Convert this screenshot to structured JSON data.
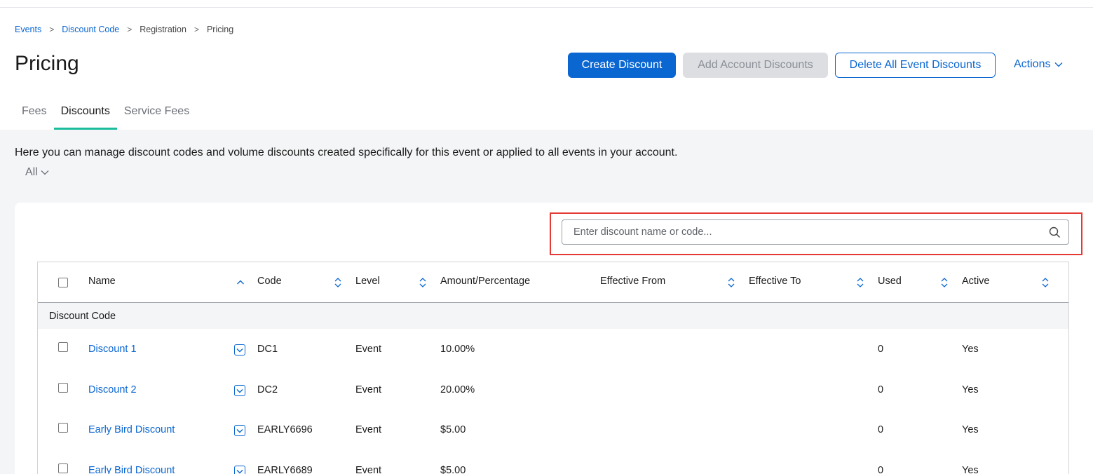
{
  "breadcrumb": {
    "items": [
      {
        "label": "Events",
        "link": true
      },
      {
        "label": "Discount Code",
        "link": true
      },
      {
        "label": "Registration",
        "link": false
      },
      {
        "label": "Pricing",
        "link": false
      }
    ],
    "separator": ">"
  },
  "page": {
    "title": "Pricing"
  },
  "toolbar": {
    "create_label": "Create Discount",
    "add_account_label": "Add Account Discounts",
    "delete_all_label": "Delete All Event Discounts",
    "actions_label": "Actions"
  },
  "tabs": [
    {
      "label": "Fees",
      "active": false
    },
    {
      "label": "Discounts",
      "active": true
    },
    {
      "label": "Service Fees",
      "active": false
    }
  ],
  "intro_text": "Here you can manage discount codes and volume discounts created specifically for this event or applied to all events in your account.",
  "filter": {
    "selected": "All"
  },
  "search": {
    "placeholder": "Enter discount name or code...",
    "value": ""
  },
  "table": {
    "columns": [
      "Name",
      "Code",
      "Level",
      "Amount/Percentage",
      "Effective From",
      "Effective To",
      "Used",
      "Active"
    ],
    "group_label": "Discount Code",
    "rows": [
      {
        "name": "Discount 1",
        "code": "DC1",
        "level": "Event",
        "amount": "10.00%",
        "from": "",
        "to": "",
        "used": "0",
        "active": "Yes"
      },
      {
        "name": "Discount 2",
        "code": "DC2",
        "level": "Event",
        "amount": "20.00%",
        "from": "",
        "to": "",
        "used": "0",
        "active": "Yes"
      },
      {
        "name": "Early Bird Discount",
        "code": "EARLY6696",
        "level": "Event",
        "amount": "$5.00",
        "from": "",
        "to": "",
        "used": "0",
        "active": "Yes"
      },
      {
        "name": "Early Bird Discount",
        "code": "EARLY6689",
        "level": "Event",
        "amount": "$5.00",
        "from": "",
        "to": "",
        "used": "0",
        "active": "Yes"
      }
    ]
  },
  "colors": {
    "accent": "#0a66d1",
    "tab_underline": "#1abc9c",
    "highlight": "#e53935"
  }
}
